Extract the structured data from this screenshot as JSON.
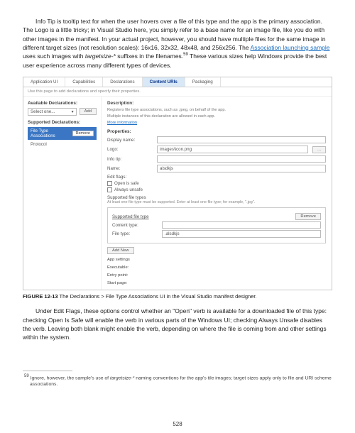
{
  "para1_a": "Info Tip is tooltip text for when the user hovers over a file of this type and the app is the primary association. The Logo is a little tricky; in Visual Studio here, you simply refer to a base name for an image file, like you do with other images in the manifest. In your actual project, however, you should have multiple files for the same image in different target sizes (not resolution scales): 16x16, 32x32, 48x48, and 256x256. The ",
  "para1_link": "Association launching sample",
  "para1_b": " uses such images with ",
  "para1_i": "targetsize-*",
  "para1_c": " suffixes in the filenames.",
  "para1_sup": "59",
  "para1_d": "  These various sizes help Windows provide the best user experience across many different types of devices.",
  "tabs": {
    "t1": "Application UI",
    "t2": "Capabilities",
    "t3": "Declarations",
    "t4": "Content URIs",
    "t5": "Packaging"
  },
  "hint": "Use this page to add declarations and specify their properties.",
  "left": {
    "avail": "Available Declarations:",
    "select_placeholder": "Select one...",
    "add": "Add",
    "supported": "Supported Declarations:",
    "item1": "File Type Associations",
    "item2": "Protocol",
    "remove": "Remove"
  },
  "right": {
    "desc_h": "Description:",
    "desc1": "Registers file type associations, such as .jpeg, on behalf of the app.",
    "desc2": "Multiple instances of this declaration are allowed in each app.",
    "more": "More information",
    "props_h": "Properties:",
    "display": "Display name:",
    "logo": "Logo:",
    "logo_v": "images\\icon.png",
    "infotip": "Info tip:",
    "name": "Name:",
    "name_v": "alsdkjs",
    "editflags": "Edit flags:",
    "openissafe": "Open is safe",
    "alwaysunsafe": "Always unsafe",
    "sft_h": "Supported file types",
    "sft_note": "At least one file type must be supported. Enter at least one file type; for example, \".jpg\".",
    "sft_label": "Supported file type",
    "remove": "Remove",
    "contenttype": "Content type:",
    "filetype": "File type:",
    "filetype_v": ".alsdkjs",
    "addnew": "Add New",
    "appsettings": "App settings",
    "executable": "Executable:",
    "entrypoint": "Entry point:",
    "startpage": "Start page:"
  },
  "caption_b": "FIGURE 12-13",
  "caption_t": "   The Declarations > File Type Associations UI in the Visual Studio manifest designer.",
  "para2": "Under Edit Flags, these options control whether an \"Open\" verb is available for a downloaded file of this type: checking Open Is Safe will enable the verb in various parts of the Windows UI; checking Always Unsafe disables the verb. Leaving both blank might enable the verb, depending on where the file is coming from and other settings within the system.",
  "fn_num": "59",
  "fn_a": "  Ignore, however, the sample's use of ",
  "fn_i": "targetsize-*",
  "fn_b": " naming conventions for the app's tile images; target sizes apply only to file and URI scheme associations.",
  "page": "528"
}
